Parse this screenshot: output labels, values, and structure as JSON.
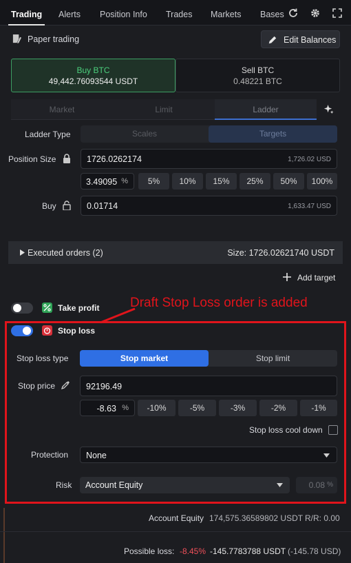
{
  "tabs": [
    "Trading",
    "Alerts",
    "Position Info",
    "Trades",
    "Markets",
    "Bases"
  ],
  "paper": {
    "label": "Paper trading",
    "edit_balances": "Edit Balances"
  },
  "buy": {
    "title": "Buy BTC",
    "amount": "49,442.76093544 USDT"
  },
  "sell": {
    "title": "Sell BTC",
    "amount": "0.48221 BTC"
  },
  "order_tabs": [
    "Market",
    "Limit",
    "Ladder"
  ],
  "ladder": {
    "label": "Ladder Type",
    "options": [
      "Scales",
      "Targets"
    ]
  },
  "position": {
    "label": "Position Size",
    "value": "1726.0262174",
    "usd": "1,726.02 USD",
    "percent": "3.49095",
    "percent_unit": "%",
    "quick": [
      "5%",
      "10%",
      "15%",
      "25%",
      "50%",
      "100%"
    ]
  },
  "buy_row": {
    "label": "Buy",
    "value": "0.01714",
    "usd": "1,633.47 USD"
  },
  "executed": {
    "label": "Executed orders (2)",
    "size": "Size: 1726.02621740 USDT"
  },
  "add_target": "Add target",
  "take_profit": "Take profit",
  "annotation": "Draft Stop Loss order is added",
  "stop_loss": {
    "title": "Stop loss",
    "type_label": "Stop loss type",
    "types": [
      "Stop market",
      "Stop limit"
    ],
    "price_label": "Stop price",
    "price": "92196.49",
    "percent": "-8.63",
    "percent_unit": "%",
    "quick": [
      "-10%",
      "-5%",
      "-3%",
      "-2%",
      "-1%"
    ],
    "cooldown": "Stop loss cool down",
    "protection_label": "Protection",
    "protection": "None",
    "risk_label": "Risk",
    "risk": "Account Equity",
    "risk_value": "0.08",
    "risk_unit": "%"
  },
  "footer": {
    "equity_label": "Account Equity",
    "equity": "174,575.36589802 USDT",
    "rr": "R/R: 0.00",
    "loss_label": "Possible loss:",
    "loss_pct": "-8.45%",
    "loss_amount": "-145.7783788 USDT",
    "loss_usd": "(-145.78 USD)"
  },
  "colors": {
    "accent_blue": "#2f6fe4",
    "buy_green": "#4cd07d",
    "annotation_red": "#e0141b",
    "loss_red": "#f0505a"
  },
  "icons": [
    "refresh-icon",
    "gear-icon",
    "expand-icon",
    "note-icon",
    "pencil-icon",
    "sparkle-icon",
    "lock-icon",
    "unlock-icon",
    "caret-right-icon",
    "plus-icon",
    "take-profit-icon",
    "stop-loss-icon",
    "eyedropper-icon",
    "chevron-down-icon"
  ]
}
